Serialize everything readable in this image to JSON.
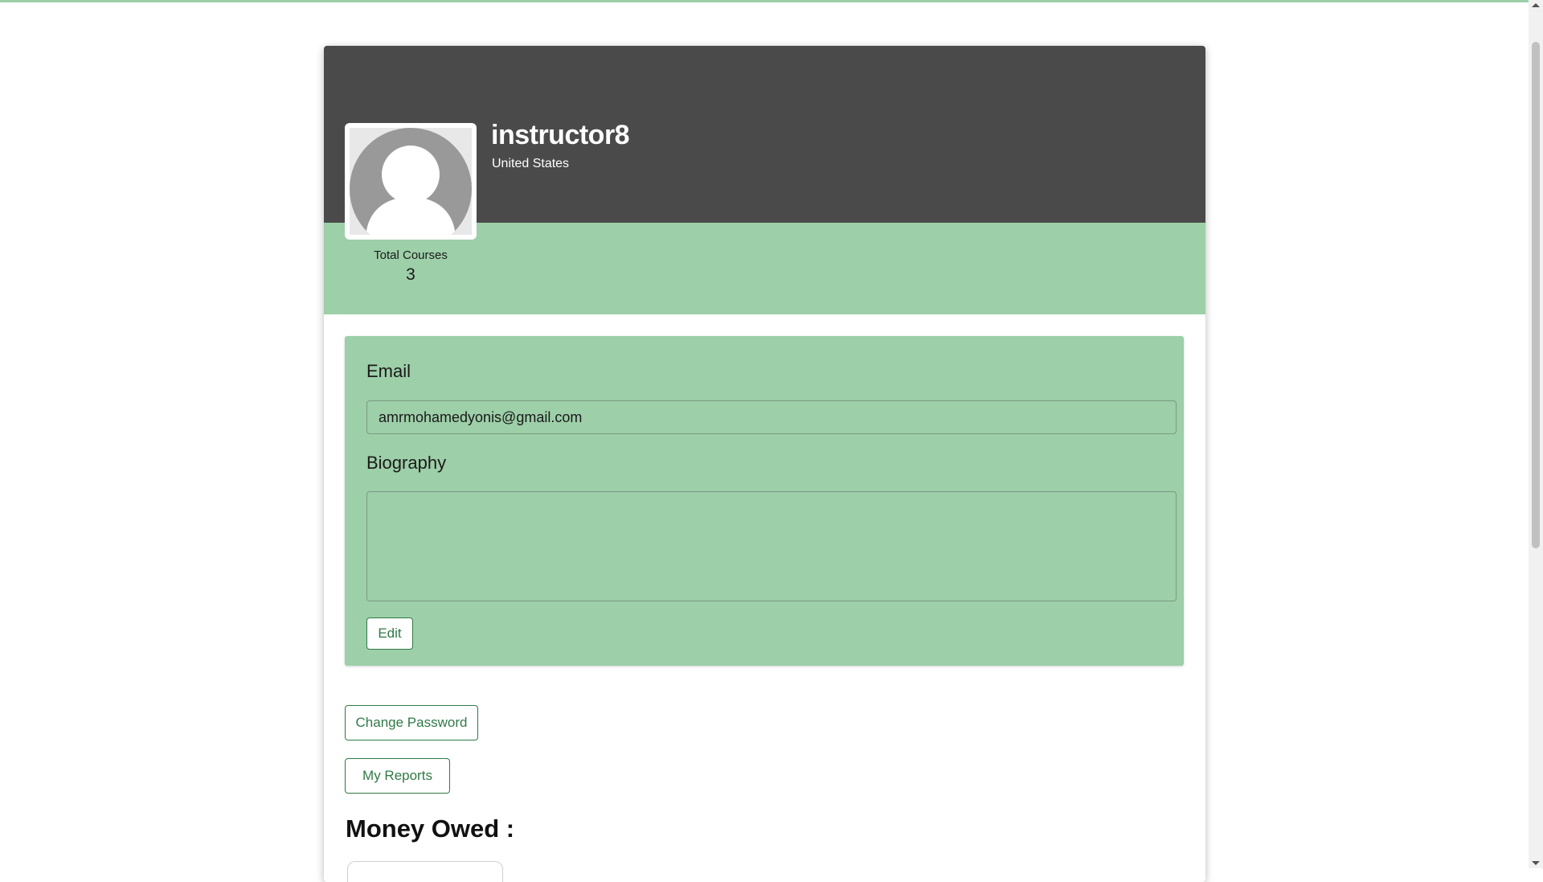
{
  "colors": {
    "header_bg": "#4a4a4a",
    "accent_green": "#9dcfa8",
    "button_green": "#2f7a45"
  },
  "profile": {
    "avatar_icon": "user-silhouette-icon",
    "username": "instructor8",
    "country": "United States",
    "stats": {
      "total_courses_label": "Total Courses",
      "total_courses_value": "3"
    }
  },
  "form": {
    "email_label": "Email",
    "email_value": "amrmohamedyonis@gmail.com",
    "biography_label": "Biography",
    "biography_value": "",
    "edit_label": "Edit"
  },
  "actions": {
    "change_password_label": "Change Password",
    "my_reports_label": "My Reports"
  },
  "money": {
    "title": "Money Owed :"
  }
}
